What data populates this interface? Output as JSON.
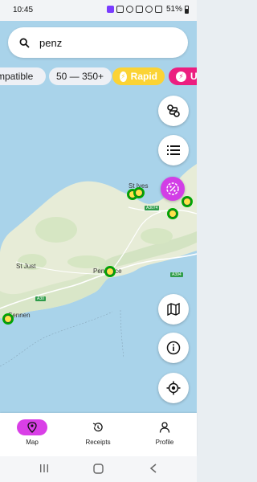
{
  "status_bar": {
    "time": "10:45",
    "battery": "51%"
  },
  "search": {
    "value": "penz"
  },
  "chips": [
    {
      "label": "mpatible"
    },
    {
      "label": "50 — 350+"
    },
    {
      "label": "Rapid"
    },
    {
      "label": "Ul"
    }
  ],
  "map_labels": {
    "st_ives": "St Ives",
    "st_just": "St Just",
    "penzance": "Penzance",
    "sennen": "Sennen",
    "a3074": "A3074",
    "a30": "A30",
    "a394": "A394"
  },
  "fabs": [
    "route-icon",
    "list-icon",
    "discount-icon",
    "map-icon",
    "info-icon",
    "locate-icon"
  ],
  "nav": {
    "map": "Map",
    "receipts": "Receipts",
    "profile": "Profile"
  },
  "colors": {
    "accent": "#d93fe7",
    "rapid": "#fbd335",
    "ultra": "#ec1e80",
    "sea": "#a9d3ea",
    "land": "#e8ecd9"
  }
}
